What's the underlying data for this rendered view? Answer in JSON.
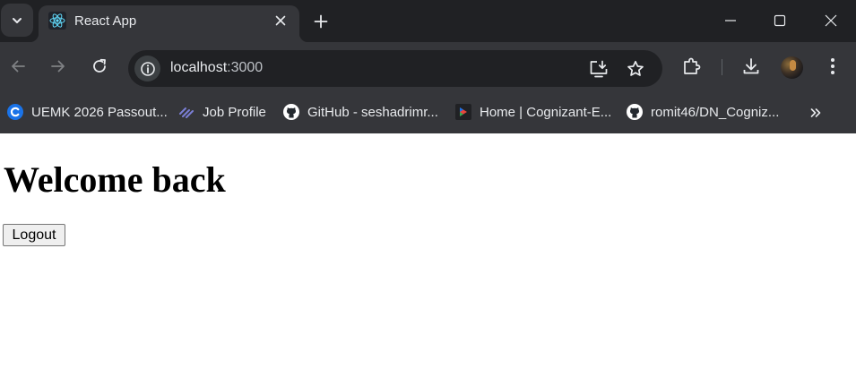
{
  "browser": {
    "tab": {
      "title": "React App",
      "favicon": "react-icon"
    },
    "address_bar": {
      "host": "localhost",
      "port": ":3000"
    },
    "bookmarks": [
      {
        "label": "UEMK 2026 Passout...",
        "icon": "circle-c-icon",
        "color": "#1a73e8"
      },
      {
        "label": "Job Profile",
        "icon": "stack-icon",
        "color": "#7b7fd6"
      },
      {
        "label": "GitHub - seshadrimr...",
        "icon": "github-icon",
        "color": "#ffffff"
      },
      {
        "label": "Home | Cognizant-E...",
        "icon": "cognizant-icon",
        "color": "#e8453c"
      },
      {
        "label": "romit46/DN_Cogniz...",
        "icon": "github-icon",
        "color": "#ffffff"
      }
    ],
    "colors": {
      "tab_strip": "#202124",
      "toolbar": "#35363a",
      "omnibox": "#202124",
      "text": "#e8eaed"
    }
  },
  "page": {
    "heading": "Welcome back",
    "logout_button": "Logout"
  }
}
